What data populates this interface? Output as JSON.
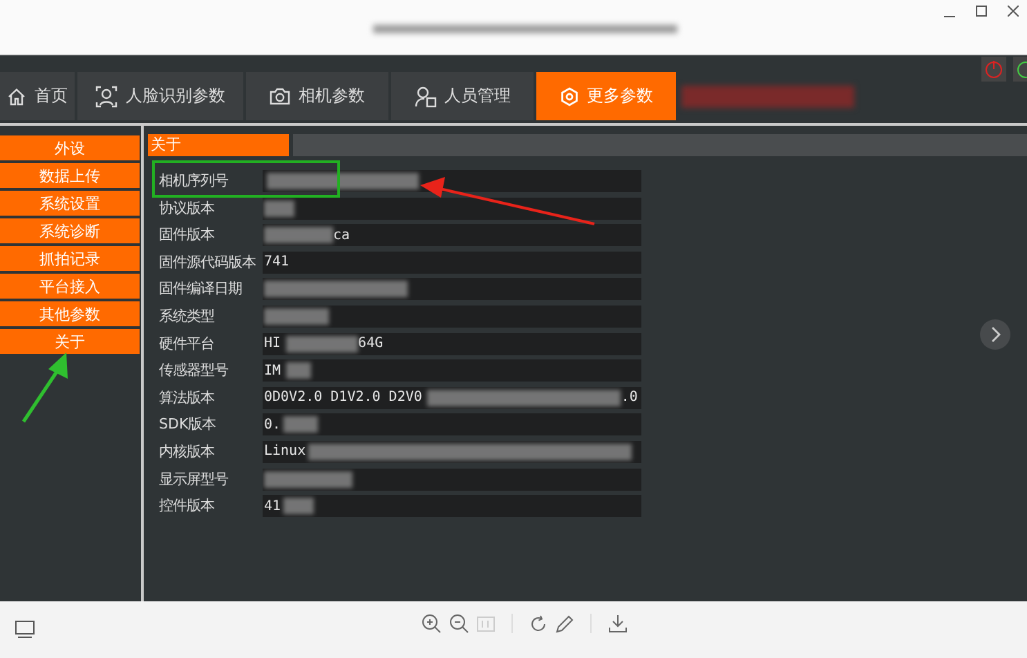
{
  "tabs": [
    {
      "label": "首页",
      "selected": false
    },
    {
      "label": "人脸识别参数",
      "selected": false
    },
    {
      "label": "相机参数",
      "selected": false
    },
    {
      "label": "人员管理",
      "selected": false
    },
    {
      "label": "更多参数",
      "selected": true
    }
  ],
  "side_menu": [
    "外设",
    "数据上传",
    "系统设置",
    "系统诊断",
    "抓拍记录",
    "平台接入",
    "其他参数",
    "关于"
  ],
  "panel": {
    "tab": "关于",
    "rows": [
      {
        "label": "相机序列号"
      },
      {
        "label": "协议版本"
      },
      {
        "label": "固件版本",
        "value_end": "ca"
      },
      {
        "label": "固件源代码版本",
        "value_start": "741"
      },
      {
        "label": "固件编译日期"
      },
      {
        "label": "系统类型"
      },
      {
        "label": "硬件平台",
        "value_start": "HI",
        "value_end": "64G"
      },
      {
        "label": "传感器型号",
        "value_start": "IM"
      },
      {
        "label": "算法版本",
        "value_start": "0D0V2.0 D1V2.0 D2V0",
        "value_end": ".0"
      },
      {
        "label": "SDK版本",
        "value_start": "0."
      },
      {
        "label": "内核版本",
        "value_start": "Linux"
      },
      {
        "label": "显示屏型号"
      },
      {
        "label": "控件版本",
        "value_start": "41"
      }
    ]
  }
}
